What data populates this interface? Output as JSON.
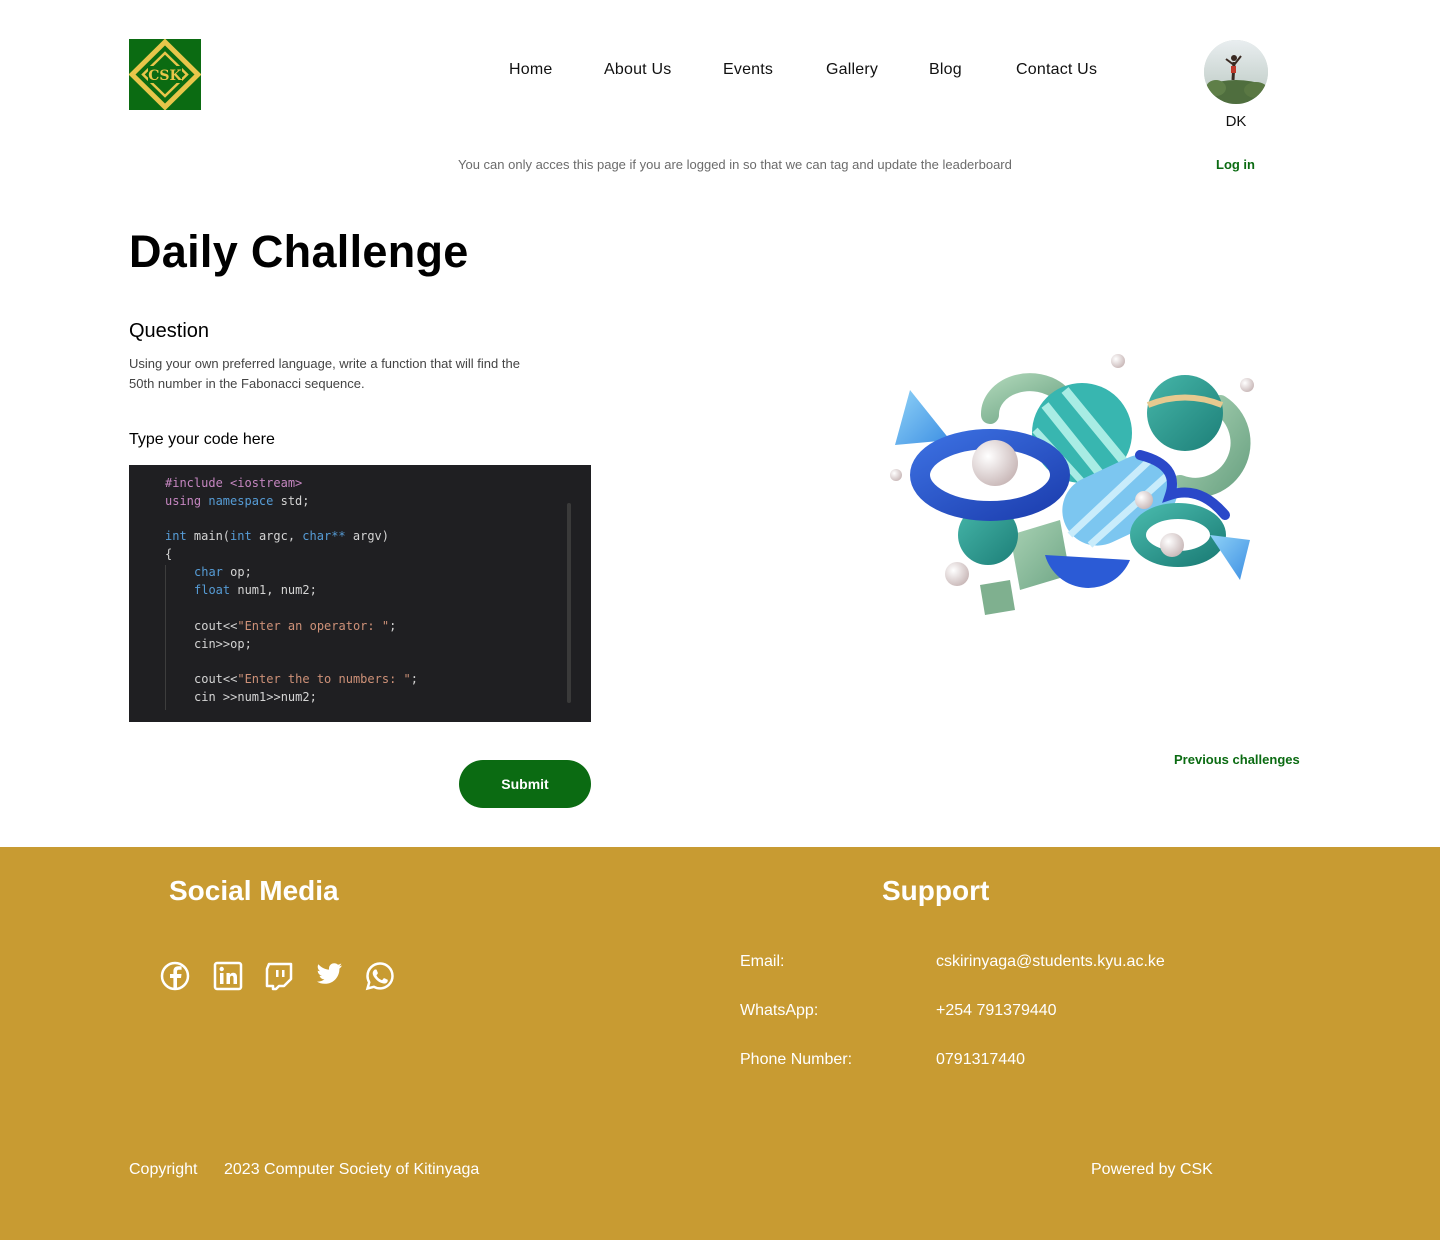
{
  "logo": {
    "text": "CSK",
    "icon": "csk-logo-icon",
    "colors": {
      "background": "#0b6b12",
      "diamond": "#e8c64a"
    }
  },
  "nav": {
    "items": [
      {
        "label": "Home"
      },
      {
        "label": "About Us"
      },
      {
        "label": "Events"
      },
      {
        "label": "Gallery"
      },
      {
        "label": "Blog"
      },
      {
        "label": "Contact Us"
      }
    ]
  },
  "user": {
    "initials": "DK"
  },
  "notice": {
    "text": "You can only acces this page if you are logged in so that we can tag and update the leaderboard",
    "login_label": "Log in"
  },
  "main": {
    "title": "Daily Challenge",
    "question_heading": "Question",
    "question_text": "Using your own preferred language, write a function that will find the 50th number in the Fabonacci sequence.",
    "code_label": "Type your code here",
    "submit_label": "Submit",
    "previous_label": "Previous challenges"
  },
  "code": {
    "lines": [
      [
        {
          "t": "#include <iostream>",
          "c": "kw-pink"
        }
      ],
      [
        {
          "t": "using ",
          "c": "kw-pink"
        },
        {
          "t": "namespace ",
          "c": "kw-blue"
        },
        {
          "t": "std;",
          "c": "txt"
        }
      ],
      [
        {
          "t": "int ",
          "c": "kw-blue"
        },
        {
          "t": "main(",
          "c": "txt"
        },
        {
          "t": "int ",
          "c": "kw-blue"
        },
        {
          "t": "argc, ",
          "c": "txt"
        },
        {
          "t": "char** ",
          "c": "kw-blue"
        },
        {
          "t": "argv)",
          "c": "txt"
        }
      ],
      [
        {
          "t": "{",
          "c": "txt"
        }
      ],
      [
        {
          "t": "char ",
          "c": "kw-blue"
        },
        {
          "t": "op;",
          "c": "txt"
        }
      ],
      [
        {
          "t": "float ",
          "c": "kw-blue"
        },
        {
          "t": "num1, num2;",
          "c": "txt"
        }
      ],
      [
        {
          "t": "cout<<",
          "c": "txt"
        },
        {
          "t": "\"Enter an operator: \"",
          "c": "str"
        },
        {
          "t": ";",
          "c": "txt"
        }
      ],
      [
        {
          "t": "cin>>op;",
          "c": "txt"
        }
      ],
      [
        {
          "t": "cout<<",
          "c": "txt"
        },
        {
          "t": "\"Enter the to numbers: \"",
          "c": "str"
        },
        {
          "t": ";",
          "c": "txt"
        }
      ],
      [
        {
          "t": "cin >>num1>>num2;",
          "c": "txt"
        }
      ]
    ]
  },
  "footer": {
    "social_heading": "Social Media",
    "support_heading": "Support",
    "social_icons": [
      "facebook-icon",
      "linkedin-icon",
      "twitch-icon",
      "twitter-icon",
      "whatsapp-icon"
    ],
    "contacts": [
      {
        "label": "Email:",
        "value": "cskirinyaga@students.kyu.ac.ke"
      },
      {
        "label": "WhatsApp:",
        "value": "+254 791379440"
      },
      {
        "label": "Phone Number:",
        "value": "0791317440"
      }
    ],
    "copyright_word": "Copyright",
    "copyright_text": "2023 Computer Society of Kitinyaga",
    "powered": "Powered by CSK",
    "color": "#c89b32"
  },
  "colors": {
    "accent": "#0b6b12",
    "footer": "#c89b32",
    "editor_bg": "#1f1f22"
  }
}
